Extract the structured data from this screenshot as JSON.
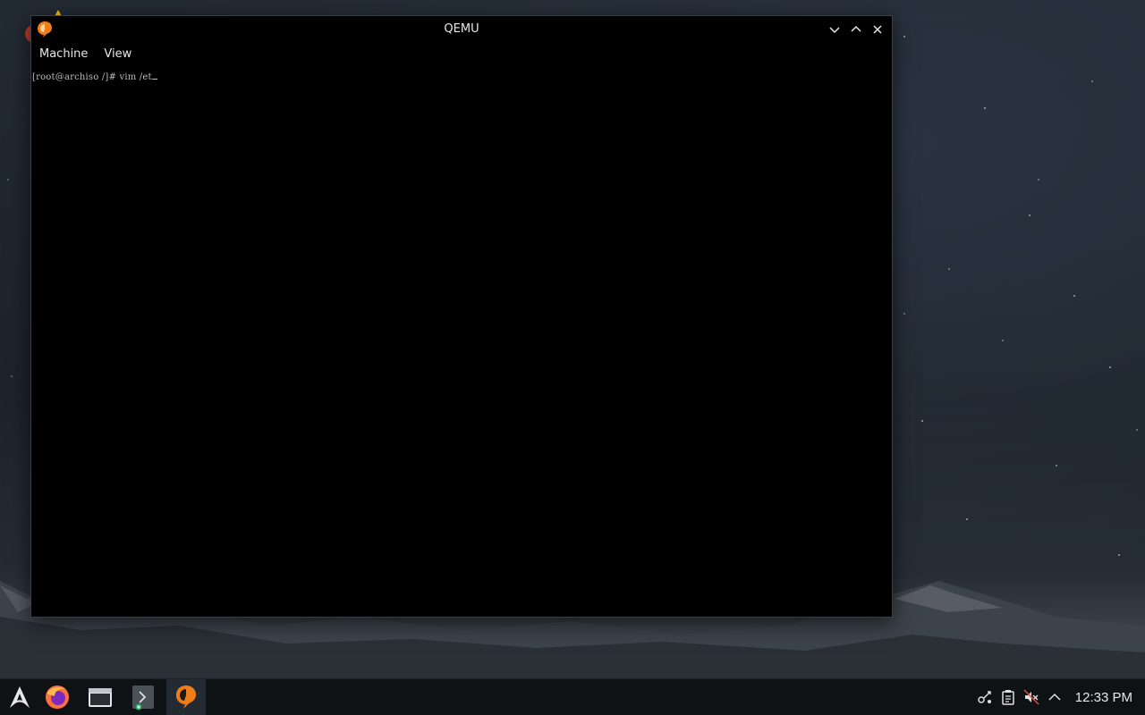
{
  "window": {
    "title": "QEMU",
    "menu": [
      "Machine",
      "View"
    ]
  },
  "console": {
    "line1": "[root@archiso /]# vim /et"
  },
  "taskbar": {
    "apps": [
      {
        "name": "arch-launcher"
      },
      {
        "name": "firefox"
      },
      {
        "name": "file-manager"
      },
      {
        "name": "terminal"
      },
      {
        "name": "qemu"
      }
    ],
    "clock": "12:33 PM"
  }
}
